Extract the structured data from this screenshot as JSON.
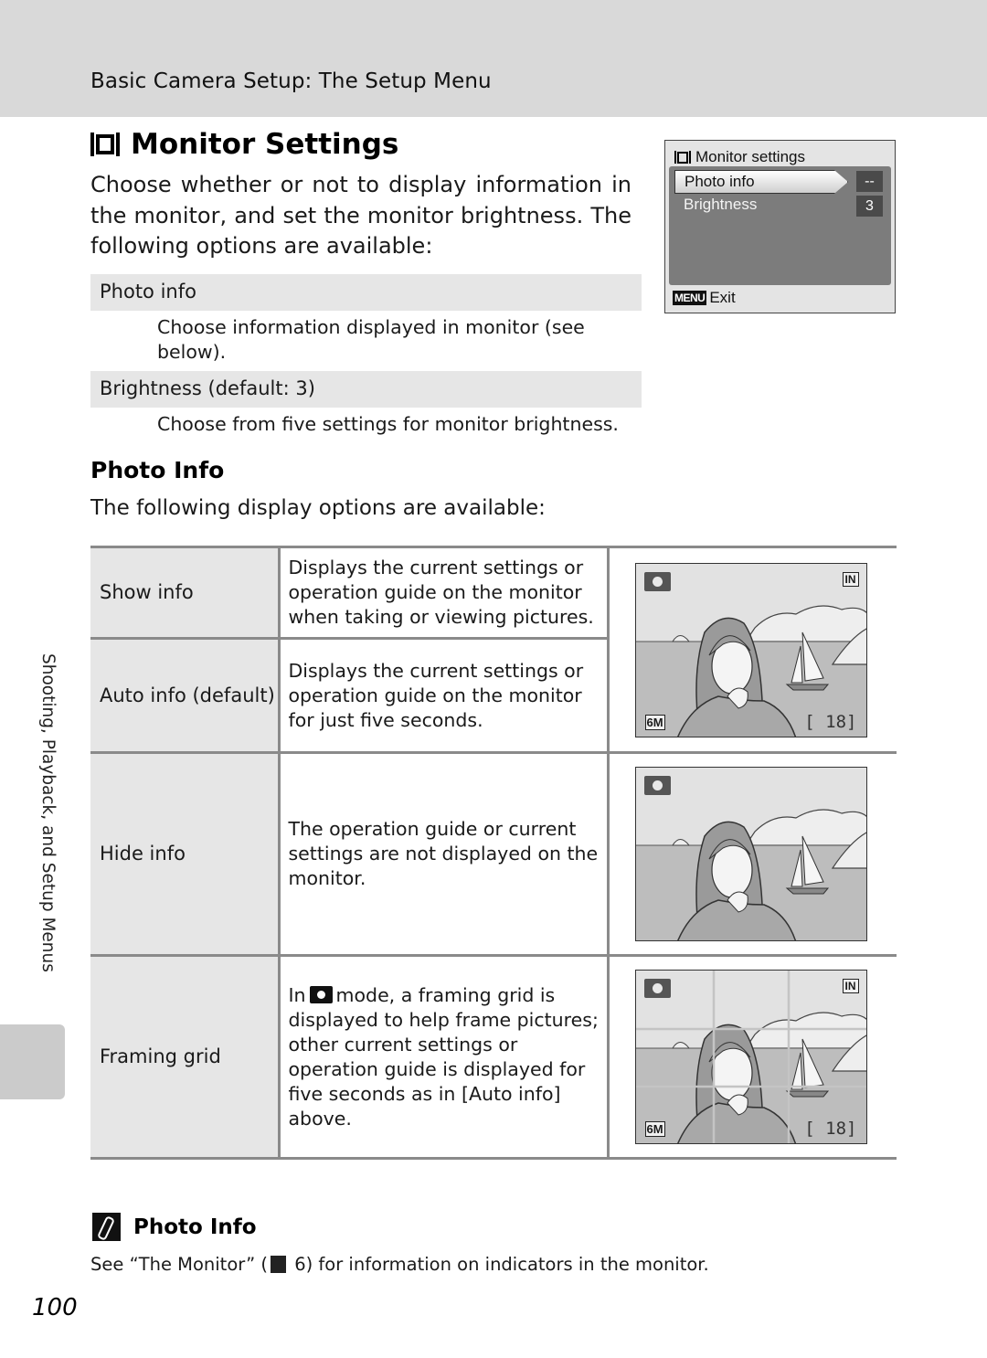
{
  "header": {
    "section_title": "Basic Camera Setup: The Setup Menu"
  },
  "page": {
    "title": "Monitor Settings",
    "title_icon": "monitor-settings-icon",
    "intro": "Choose whether or not to display information in the monitor, and set the monitor brightness. The following options are available:",
    "options": [
      {
        "label": "Photo info",
        "description": "Choose information displayed in monitor (see below)."
      },
      {
        "label": "Brightness (default: 3)",
        "description": "Choose from five settings for monitor brightness."
      }
    ],
    "page_number": "100"
  },
  "camera_menu": {
    "title": "Monitor settings",
    "items": [
      {
        "label": "Photo info",
        "value": "--",
        "selected": true
      },
      {
        "label": "Brightness",
        "value": "3",
        "selected": false
      }
    ],
    "footer_key": "MENU",
    "footer_label": "Exit"
  },
  "photo_info": {
    "heading": "Photo Info",
    "intro": "The following display options are available:",
    "rows": [
      {
        "name": "Show info",
        "description": "Displays the current settings or operation guide on the monitor when taking or viewing pictures.",
        "preview": {
          "overlays": true,
          "grid": false
        }
      },
      {
        "name": "Auto info (default)",
        "description": "Displays the current settings or operation guide on the monitor for just five seconds.",
        "preview": {
          "overlays": true,
          "grid": false
        }
      },
      {
        "name": "Hide info",
        "description": "The operation guide or current settings are not displayed on the monitor.",
        "preview": {
          "overlays": false,
          "grid": false
        }
      },
      {
        "name": "Framing grid",
        "description_prefix": "In",
        "description_icon": "camera-mode-icon",
        "description": "mode, a framing grid is displayed to help frame pictures; other current settings or operation guide is displayed for five seconds as in [Auto info] above.",
        "preview": {
          "overlays": true,
          "grid": true
        }
      }
    ],
    "preview_indicators": {
      "memory": "IN",
      "image_size": "6M",
      "exposures_remaining": "[   18]"
    }
  },
  "note": {
    "icon": "note-pencil-icon",
    "title": "Photo Info",
    "text_before": "See “The Monitor” (",
    "ref_icon": "reference-page-icon",
    "text_after": " 6) for information on indicators in the monitor."
  },
  "side_tab": {
    "label": "Shooting, Playback, and Setup Menus"
  }
}
